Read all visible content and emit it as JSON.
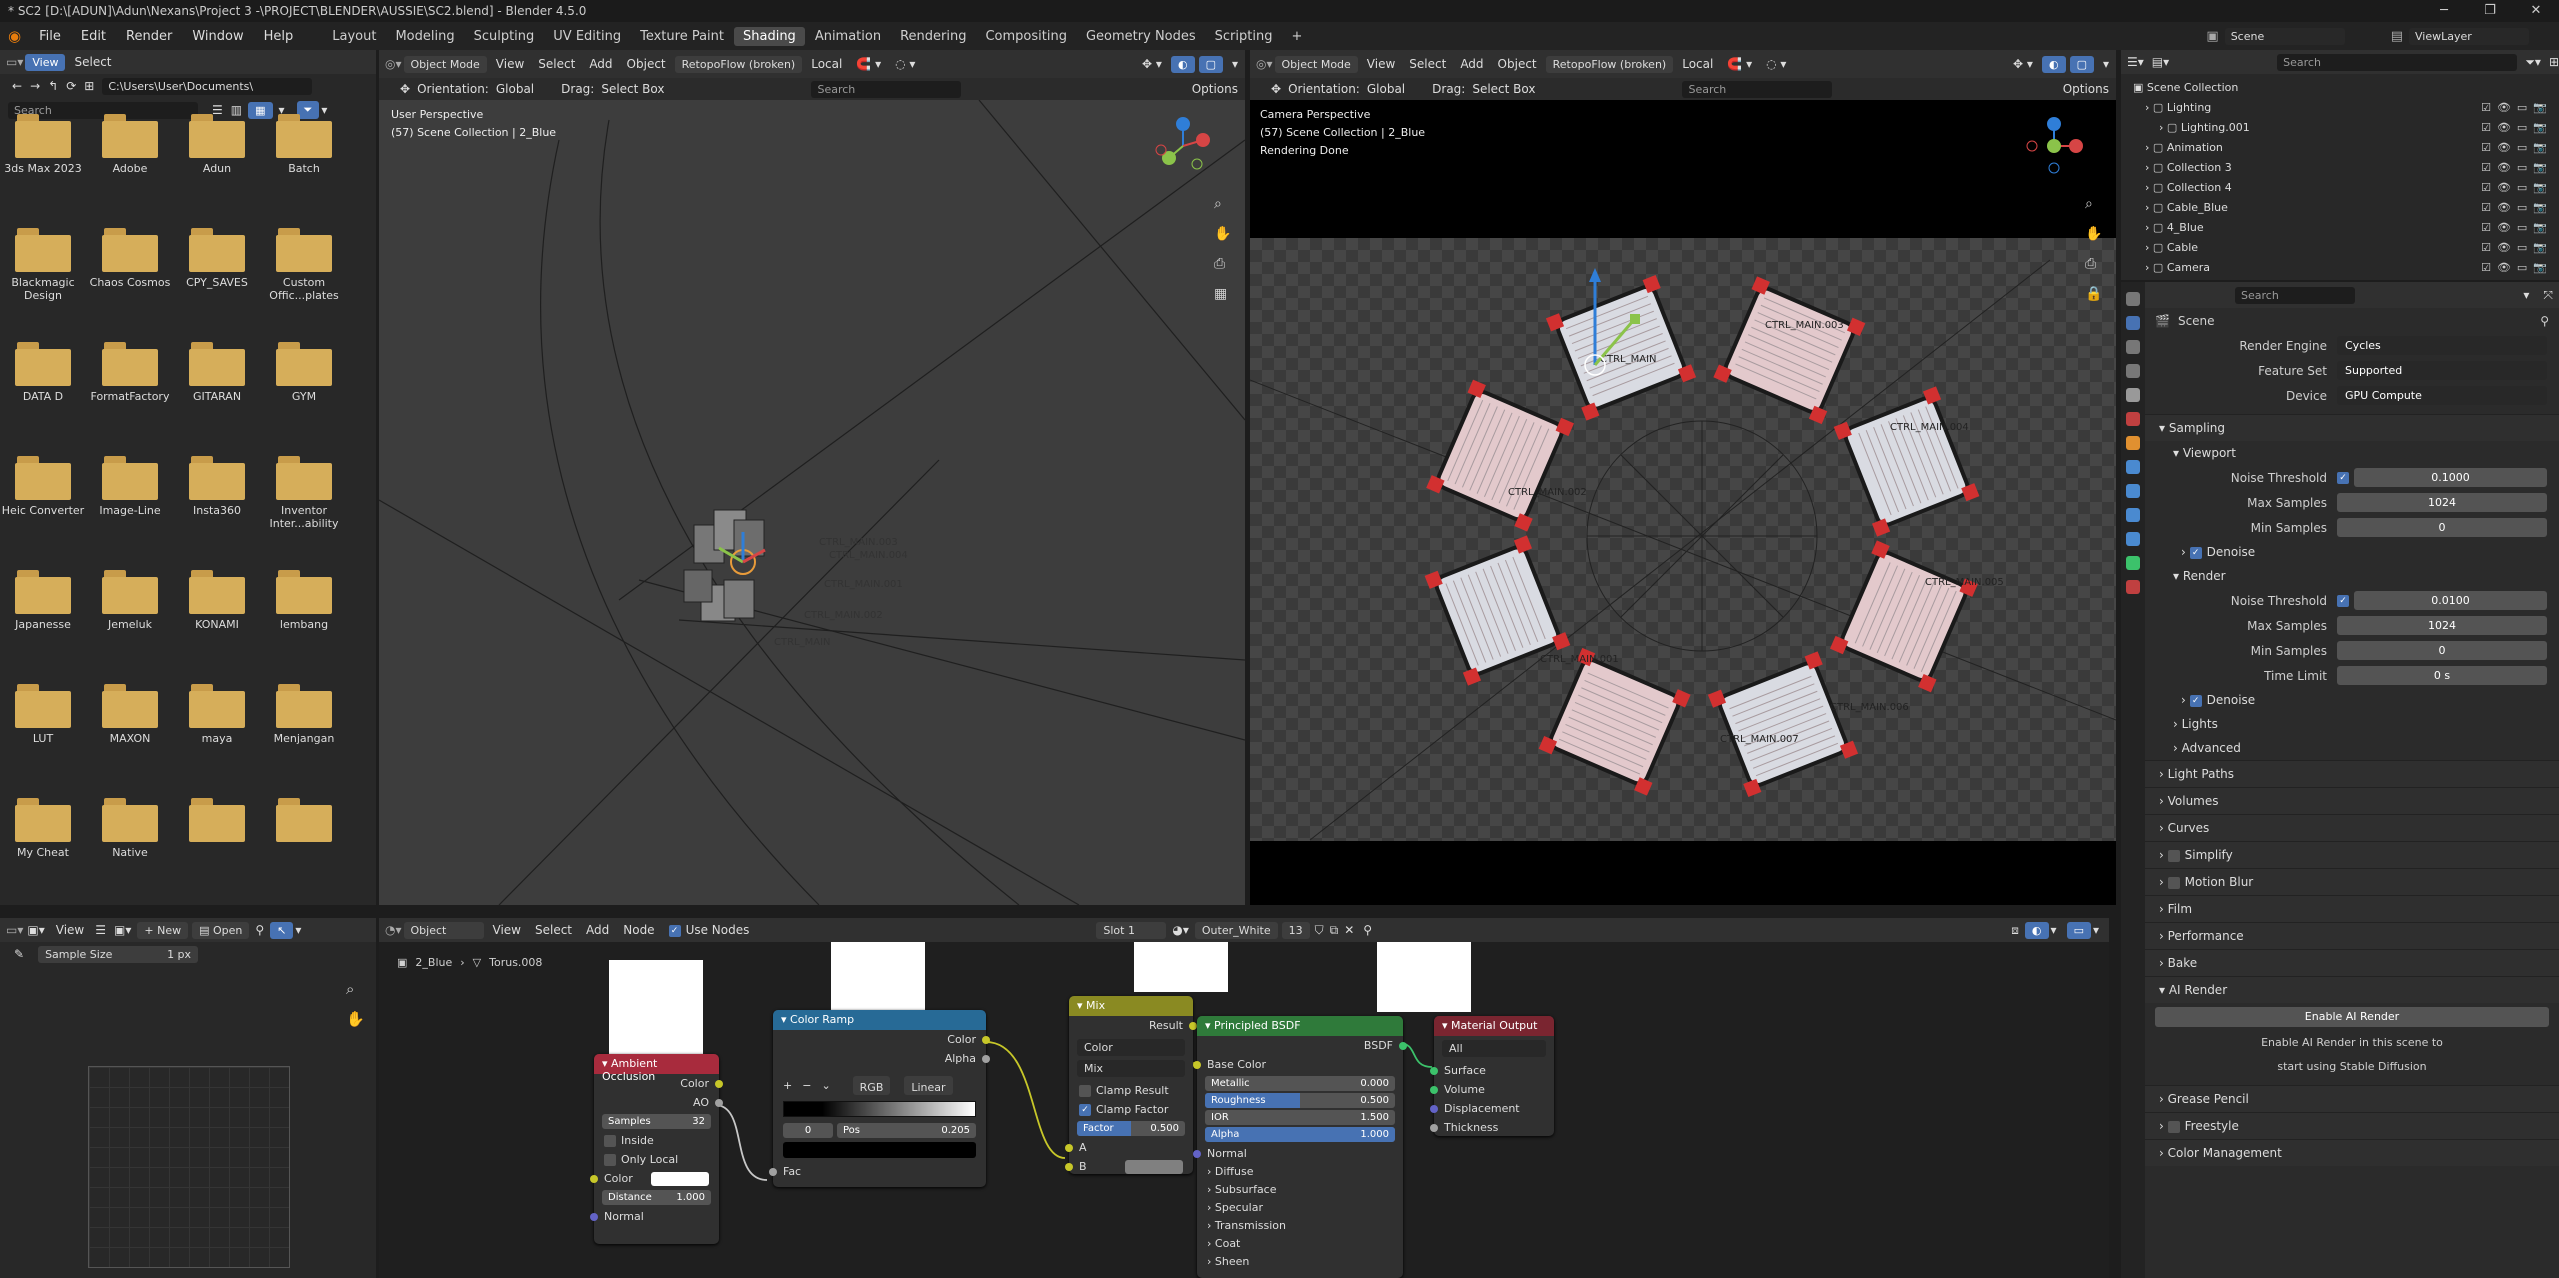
{
  "window": {
    "title": "* SC2 [D:\\[ADUN]\\Adun\\Nexans\\Project 3 -\\PROJECT\\BLENDER\\AUSSIE\\SC2.blend] - Blender 4.5.0",
    "controls": [
      "─",
      "❐",
      "✕"
    ]
  },
  "menu": [
    "File",
    "Edit",
    "Render",
    "Window",
    "Help"
  ],
  "workspaces": [
    {
      "label": "Layout"
    },
    {
      "label": "Modeling"
    },
    {
      "label": "Sculpting"
    },
    {
      "label": "UV Editing"
    },
    {
      "label": "Texture Paint"
    },
    {
      "label": "Shading",
      "active": true
    },
    {
      "label": "Animation"
    },
    {
      "label": "Rendering"
    },
    {
      "label": "Compositing"
    },
    {
      "label": "Geometry Nodes"
    },
    {
      "label": "Scripting"
    }
  ],
  "scene_header": {
    "scene": "Scene",
    "view_layer": "ViewLayer"
  },
  "file_browser": {
    "view": "View",
    "select": "Select",
    "path": "C:\\Users\\User\\Documents\\",
    "search_placeholder": "Search",
    "folders": [
      "3ds Max 2023",
      "Adobe",
      "Adun",
      "Batch",
      "Blackmagic Design",
      "Chaos Cosmos",
      "CPY_SAVES",
      "Custom Offic...plates",
      "DATA D",
      "FormatFactory",
      "GITARAN",
      "GYM",
      "Heic Converter",
      "Image-Line",
      "Insta360",
      "Inventor Inter...ability",
      "Japanesse",
      "Jemeluk",
      "KONAMI",
      "lembang",
      "LUT",
      "MAXON",
      "maya",
      "Menjangan",
      "My Cheat",
      "Native",
      "",
      ""
    ]
  },
  "image_editor": {
    "view": "View",
    "new": "New",
    "open": "Open",
    "sample_label": "Sample Size",
    "sample_value": "1 px"
  },
  "viewport_left": {
    "mode": "Object Mode",
    "menus": [
      "View",
      "Select",
      "Add",
      "Object"
    ],
    "addon": "RetopoFlow (broken)",
    "orientation_label": "Orientation:",
    "orientation": "Global",
    "drag_label": "Drag:",
    "drag": "Select Box",
    "pivot": "Local",
    "search_placeholder": "Search",
    "options": "Options",
    "info_line1": "User Perspective",
    "info_line2": "(57) Scene Collection | 2_Blue",
    "labels": [
      "CTRL_MAIN.003",
      "CTRL_MAIN.004",
      "CTRL_MAIN.001",
      "CTRL_MAIN.002",
      "CTRL_MAIN"
    ]
  },
  "viewport_right": {
    "mode": "Object Mode",
    "menus": [
      "View",
      "Select",
      "Add",
      "Object"
    ],
    "addon": "RetopoFlow (broken)",
    "orientation_label": "Orientation:",
    "orientation": "Global",
    "drag_label": "Drag:",
    "drag": "Select Box",
    "pivot": "Local",
    "search_placeholder": "Search",
    "options": "Options",
    "info_line1": "Camera Perspective",
    "info_line2": "(57) Scene Collection | 2_Blue",
    "info_line3": "Rendering Done",
    "labels": [
      "CTRL_MAIN",
      "CTRL_MAIN.003",
      "CTRL_MAIN.004",
      "CTRL_MAIN.005",
      "CTRL_MAIN.006",
      "CTRL_MAIN.007",
      "CTRL_MAIN.001",
      "CTRL_MAIN.002"
    ]
  },
  "node_editor": {
    "type": "Object",
    "menus": [
      "View",
      "Select",
      "Add",
      "Node"
    ],
    "use_nodes": "Use Nodes",
    "slot": "Slot 1",
    "material": "Outer_White",
    "users": "13",
    "breadcrumb": [
      "2_Blue",
      "Torus.008"
    ],
    "nodes": {
      "ao": {
        "title": "Ambient Occlusion",
        "out1": "Color",
        "out2": "AO",
        "samples_label": "Samples",
        "samples": "32",
        "inside": "Inside",
        "only_local": "Only Local",
        "color": "Color",
        "distance_label": "Distance",
        "distance": "1.000",
        "normal": "Normal",
        "header_color": "#a82b3d"
      },
      "ramp": {
        "title": "Color Ramp",
        "out1": "Color",
        "out2": "Alpha",
        "mode": "RGB",
        "interp": "Linear",
        "index": "0",
        "pos_label": "Pos",
        "pos": "0.205",
        "fac": "Fac",
        "header_color": "#276a96"
      },
      "mix": {
        "title": "Mix",
        "out1": "Result",
        "type": "Color",
        "blend": "Mix",
        "clamp_result": "Clamp Result",
        "clamp_factor": "Clamp Factor",
        "factor_label": "Factor",
        "factor": "0.500",
        "factor_fraction": 0.5,
        "a": "A",
        "b": "B",
        "header_color": "#8a8a22"
      },
      "bsdf": {
        "title": "Principled BSDF",
        "out1": "BSDF",
        "base_color": "Base Color",
        "metallic_label": "Metallic",
        "metallic": "0.000",
        "metallic_fraction": 0.0,
        "roughness_label": "Roughness",
        "roughness": "0.500",
        "roughness_fraction": 0.5,
        "ior_label": "IOR",
        "ior": "1.500",
        "alpha_label": "Alpha",
        "alpha": "1.000",
        "alpha_fraction": 1.0,
        "normal": "Normal",
        "panels": [
          "Diffuse",
          "Subsurface",
          "Specular",
          "Transmission",
          "Coat",
          "Sheen"
        ],
        "header_color": "#2f7a3a"
      },
      "output": {
        "title": "Material Output",
        "target": "All",
        "inputs": [
          "Surface",
          "Volume",
          "Displacement",
          "Thickness"
        ],
        "header_color": "#7a2530"
      }
    }
  },
  "outliner": {
    "search_placeholder": "Search",
    "root": "Scene Collection",
    "items": [
      "Lighting",
      "Lighting.001",
      "Animation",
      "Collection 3",
      "Collection 4",
      "Cable_Blue",
      "4_Blue",
      "Cable",
      "Camera"
    ]
  },
  "properties": {
    "search_placeholder": "Search",
    "context": "Scene",
    "render_engine_label": "Render Engine",
    "render_engine": "Cycles",
    "feature_set_label": "Feature Set",
    "feature_set": "Supported",
    "device_label": "Device",
    "device": "GPU Compute",
    "sampling": "Sampling",
    "viewport": "Viewport",
    "vp_noise_label": "Noise Threshold",
    "vp_noise": "0.1000",
    "vp_max_label": "Max Samples",
    "vp_max": "1024",
    "vp_min_label": "Min Samples",
    "vp_min": "0",
    "denoise": "Denoise",
    "render": "Render",
    "r_noise_label": "Noise Threshold",
    "r_noise": "0.0100",
    "r_max_label": "Max Samples",
    "r_max": "1024",
    "r_min_label": "Min Samples",
    "r_min": "0",
    "time_label": "Time Limit",
    "time": "0 s",
    "lights": "Lights",
    "advanced": "Advanced",
    "panels": [
      "Light Paths",
      "Volumes",
      "Curves",
      "Simplify",
      "Motion Blur",
      "Film",
      "Performance",
      "Bake"
    ],
    "ai_render": "AI Render",
    "ai_button": "Enable AI Render",
    "ai_text1": "Enable AI Render in this scene to",
    "ai_text2": "start using Stable Diffusion",
    "panels2": [
      "Grease Pencil",
      "Freestyle",
      "Color Management"
    ]
  }
}
